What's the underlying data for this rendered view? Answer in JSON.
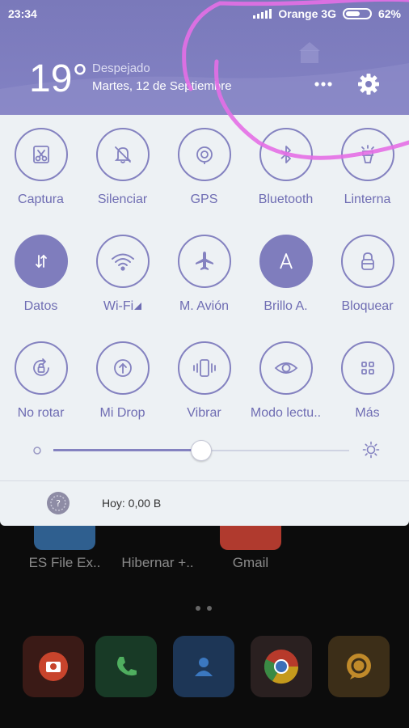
{
  "status_bar": {
    "time": "23:34",
    "carrier": "Orange 3G",
    "battery": "62%",
    "battery_level": 0.62
  },
  "weather": {
    "temperature": "19°",
    "condition": "Despejado",
    "date": "Martes, 12 de Septiembre"
  },
  "header_actions": {
    "more_icon": "more-dots-icon",
    "settings_icon": "gear-icon"
  },
  "toggles": [
    {
      "label": "Captura",
      "icon": "screenshot-scissors-icon",
      "active": false
    },
    {
      "label": "Silenciar",
      "icon": "bell-off-icon",
      "active": false
    },
    {
      "label": "GPS",
      "icon": "gps-icon",
      "active": false
    },
    {
      "label": "Bluetooth",
      "icon": "bluetooth-icon",
      "active": false
    },
    {
      "label": "Linterna",
      "icon": "flashlight-icon",
      "active": false
    },
    {
      "label": "Datos",
      "icon": "data-arrows-icon",
      "active": true
    },
    {
      "label": "Wi-Fi",
      "icon": "wifi-icon",
      "active": false
    },
    {
      "label": "M. Avión",
      "icon": "airplane-icon",
      "active": false
    },
    {
      "label": "Brillo A.",
      "icon": "auto-brightness-a-icon",
      "active": true
    },
    {
      "label": "Bloquear",
      "icon": "lock-icon",
      "active": false
    },
    {
      "label": "No rotar",
      "icon": "rotation-lock-icon",
      "active": false
    },
    {
      "label": "Mi Drop",
      "icon": "upload-arrow-icon",
      "active": false
    },
    {
      "label": "Vibrar",
      "icon": "vibrate-icon",
      "active": false
    },
    {
      "label": "Modo lectu..",
      "icon": "eye-icon",
      "active": false
    },
    {
      "label": "Más",
      "icon": "grid-icon",
      "active": false
    }
  ],
  "brightness": {
    "level": 0.5,
    "min_icon": "brightness-low-icon",
    "max_icon": "brightness-high-icon"
  },
  "data_usage": {
    "text": "Hoy: 0,00 B",
    "icon": "data-usage-icon"
  },
  "home_screen": {
    "apps": [
      "ES File Ex..",
      "Hibernar +..",
      "Gmail"
    ],
    "dock_icons": [
      "camera-icon",
      "phone-icon",
      "contacts-icon",
      "chrome-icon",
      "messaging-icon"
    ]
  },
  "colors": {
    "accent": "#8482c0",
    "header": "#7f7ebf",
    "panel_bg": "#edf1f4",
    "annotation": "#e46fe6"
  }
}
